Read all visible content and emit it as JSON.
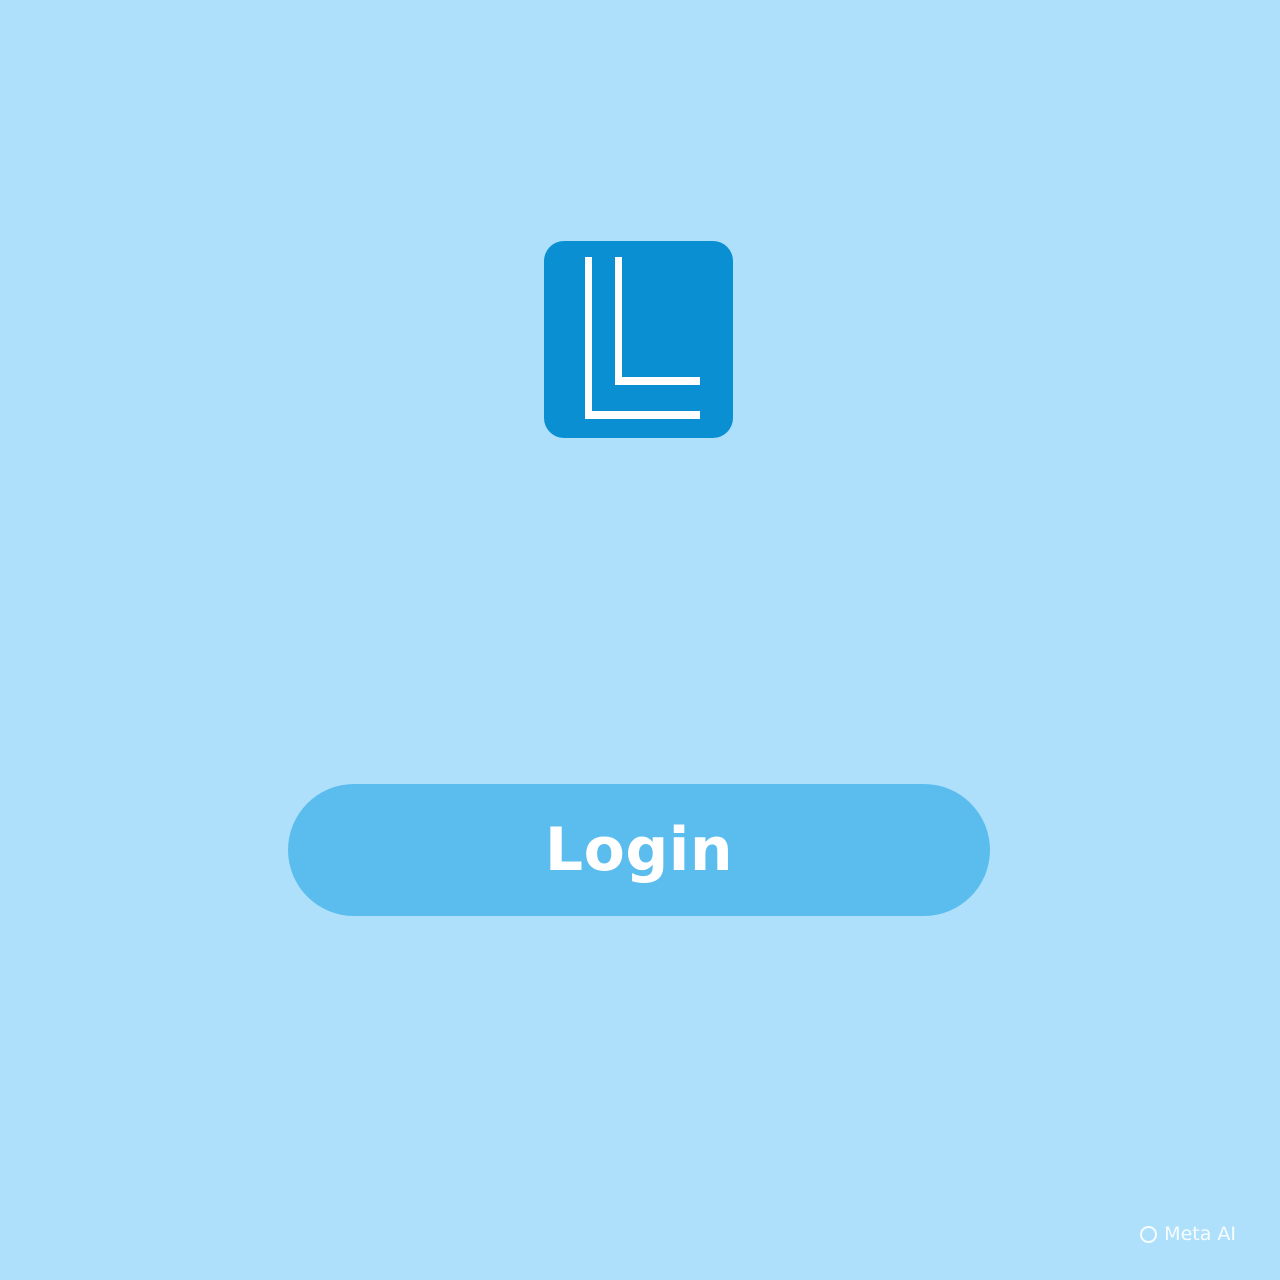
{
  "app": {
    "logo_icon": "ll-logo-icon",
    "logo_color": "#0a8fd2",
    "background_color": "#aee0fc"
  },
  "login": {
    "button_label": "Login",
    "button_color": "#5bbdee"
  },
  "watermark": {
    "text": "Meta AI",
    "icon": "meta-ring-icon"
  }
}
